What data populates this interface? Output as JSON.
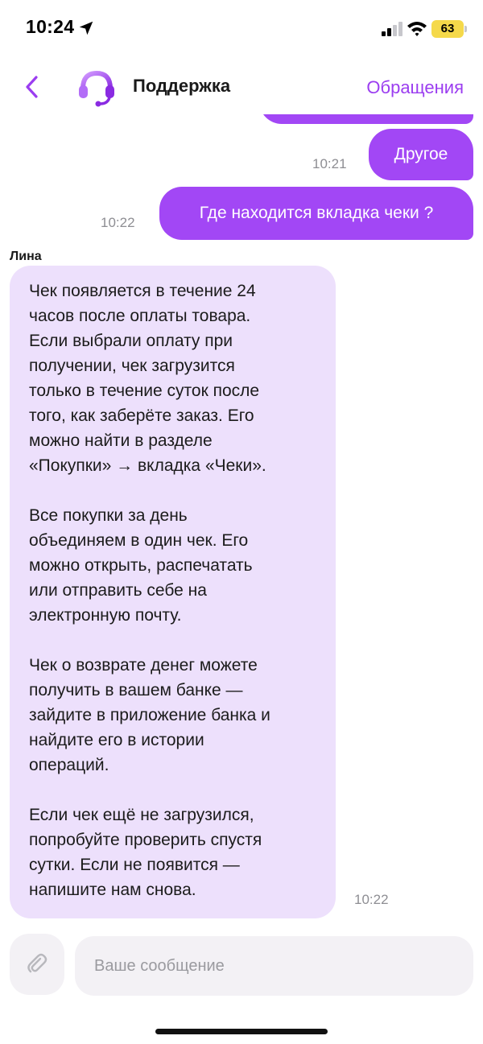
{
  "status_bar": {
    "time": "10:24",
    "battery": "63",
    "icons": [
      "location-arrow-icon",
      "cellular-signal-icon",
      "wifi-icon",
      "battery-icon"
    ]
  },
  "header": {
    "title": "Поддержка",
    "link": "Обращения",
    "icons": [
      "chevron-left-icon",
      "headset-avatar-icon"
    ]
  },
  "colors": {
    "accent": "#a247f5",
    "incoming_bubble": "#ede0fc",
    "battery": "#f5d94a"
  },
  "messages": {
    "out1": {
      "text": "Другое",
      "time": "10:21"
    },
    "out2": {
      "text": "Где находится вкладка чеки ?",
      "time": "10:22"
    },
    "incoming": {
      "sender": "Лина",
      "time": "10:22",
      "paragraphs": [
        "Чек появляется в течение 24\nчасов после оплаты товара.\nЕсли выбрали оплату при\nполучении, чек загрузится\nтолько в течение суток после\nтого, как заберёте заказ. Его\nможно найти в разделе\n«Покупки» → вкладка «Чеки».",
        "Все покупки за день\nобъединяем в один чек. Его\nможно открыть, распечатать\nили отправить себе на\nэлектронную почту.",
        "Чек о возврате денег можете\nполучить в вашем банке —\nзайдите в приложение банка и\nнайдите его в истории\nопераций.",
        "Если чек ещё не загрузился,\nпопробуйте проверить спустя\nсутки. Если не появится —\nнапишите нам снова."
      ]
    }
  },
  "composer": {
    "placeholder": "Ваше сообщение",
    "value": "",
    "icon": "paperclip-icon"
  }
}
